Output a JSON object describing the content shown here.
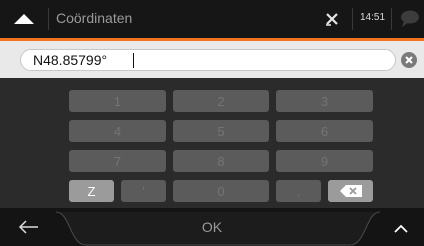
{
  "header": {
    "title": "Coördinaten",
    "time": "14:51",
    "icons": [
      "up-arrow-icon",
      "gps-icon",
      "message-icon"
    ]
  },
  "input": {
    "value": "N48.85799°"
  },
  "keypad": {
    "rows": [
      [
        "1",
        "2",
        "3"
      ],
      [
        "4",
        "5",
        "6"
      ],
      [
        "7",
        "8",
        "9"
      ]
    ],
    "bottom_row": {
      "z": "Z",
      "apostrophe": "'",
      "zero": "0",
      "dot": "."
    }
  },
  "footer": {
    "ok_label": "OK",
    "icons": [
      "back-arrow-icon",
      "chevron-up-icon"
    ]
  },
  "colors": {
    "accent": "#f0731e",
    "header_bg": "#161616",
    "input_band": "#e9e9e9",
    "key_inactive": "#5b5b5b",
    "key_active": "#9b9b9b"
  }
}
